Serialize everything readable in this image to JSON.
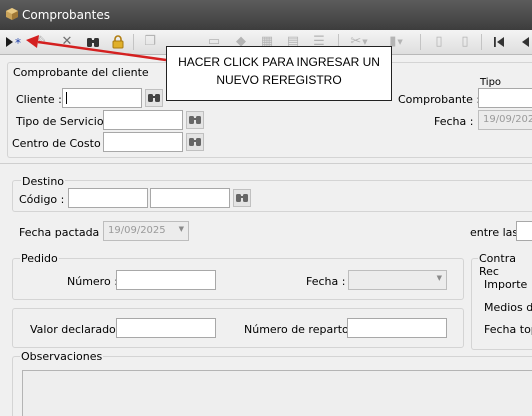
{
  "window": {
    "title": "Comprobantes",
    "icon": "box-icon"
  },
  "toolbar": {
    "buttons": [
      {
        "name": "new-record-button",
        "icon": "play-asterisk-icon",
        "enabled": true
      },
      {
        "name": "edit-button",
        "icon": "pencil-icon",
        "enabled": false
      },
      {
        "name": "delete-button",
        "icon": "x-icon",
        "enabled": false
      },
      {
        "name": "search-button",
        "icon": "binoculars-icon",
        "enabled": true
      },
      {
        "name": "lock-button",
        "icon": "lock-icon",
        "enabled": true
      },
      {
        "name": "first-record-button",
        "icon": "skip-first-icon",
        "enabled": true
      },
      {
        "name": "prev-record-button",
        "icon": "prev-icon",
        "enabled": true
      }
    ]
  },
  "callout": {
    "line1": "HACER CLICK PARA INGRESAR UN",
    "line2": "NUEVO REREGISTRO",
    "color": "#d42020"
  },
  "header": {
    "group_title": "Comprobante del cliente",
    "cliente_label": "Cliente :",
    "cliente_value": "",
    "tipo_servicio_label": "Tipo de Servicio :",
    "tipo_servicio_value": "",
    "centro_costo_label": "Centro de Costo :",
    "centro_costo_value": "",
    "tipo_header": "Tipo",
    "comprobante_label": "Comprobante :",
    "comprobante_value": "",
    "fecha_label": "Fecha :",
    "fecha_value": "19/09/202"
  },
  "destino": {
    "title": "Destino",
    "codigo_label": "Código :",
    "codigo_value": "",
    "codigo_desc": "",
    "fecha_pactada_label": "Fecha pactada :",
    "fecha_pactada_value": "19/09/2025",
    "entre_las_label": "entre las",
    "entre_las_value": ""
  },
  "pedido": {
    "title": "Pedido",
    "numero_label": "Número :",
    "numero_value": "",
    "fecha_label": "Fecha :",
    "fecha_value": ""
  },
  "contra": {
    "title": "Contra Rec",
    "importe_label": "Importe :",
    "medios_label": "Medios de",
    "fecha_tope_label": "Fecha top"
  },
  "valor": {
    "valor_declarado_label": "Valor declarado :",
    "valor_declarado_value": "",
    "numero_reparto_label": "Número de reparto :",
    "numero_reparto_value": ""
  },
  "observaciones": {
    "title": "Observaciones",
    "value": ""
  }
}
